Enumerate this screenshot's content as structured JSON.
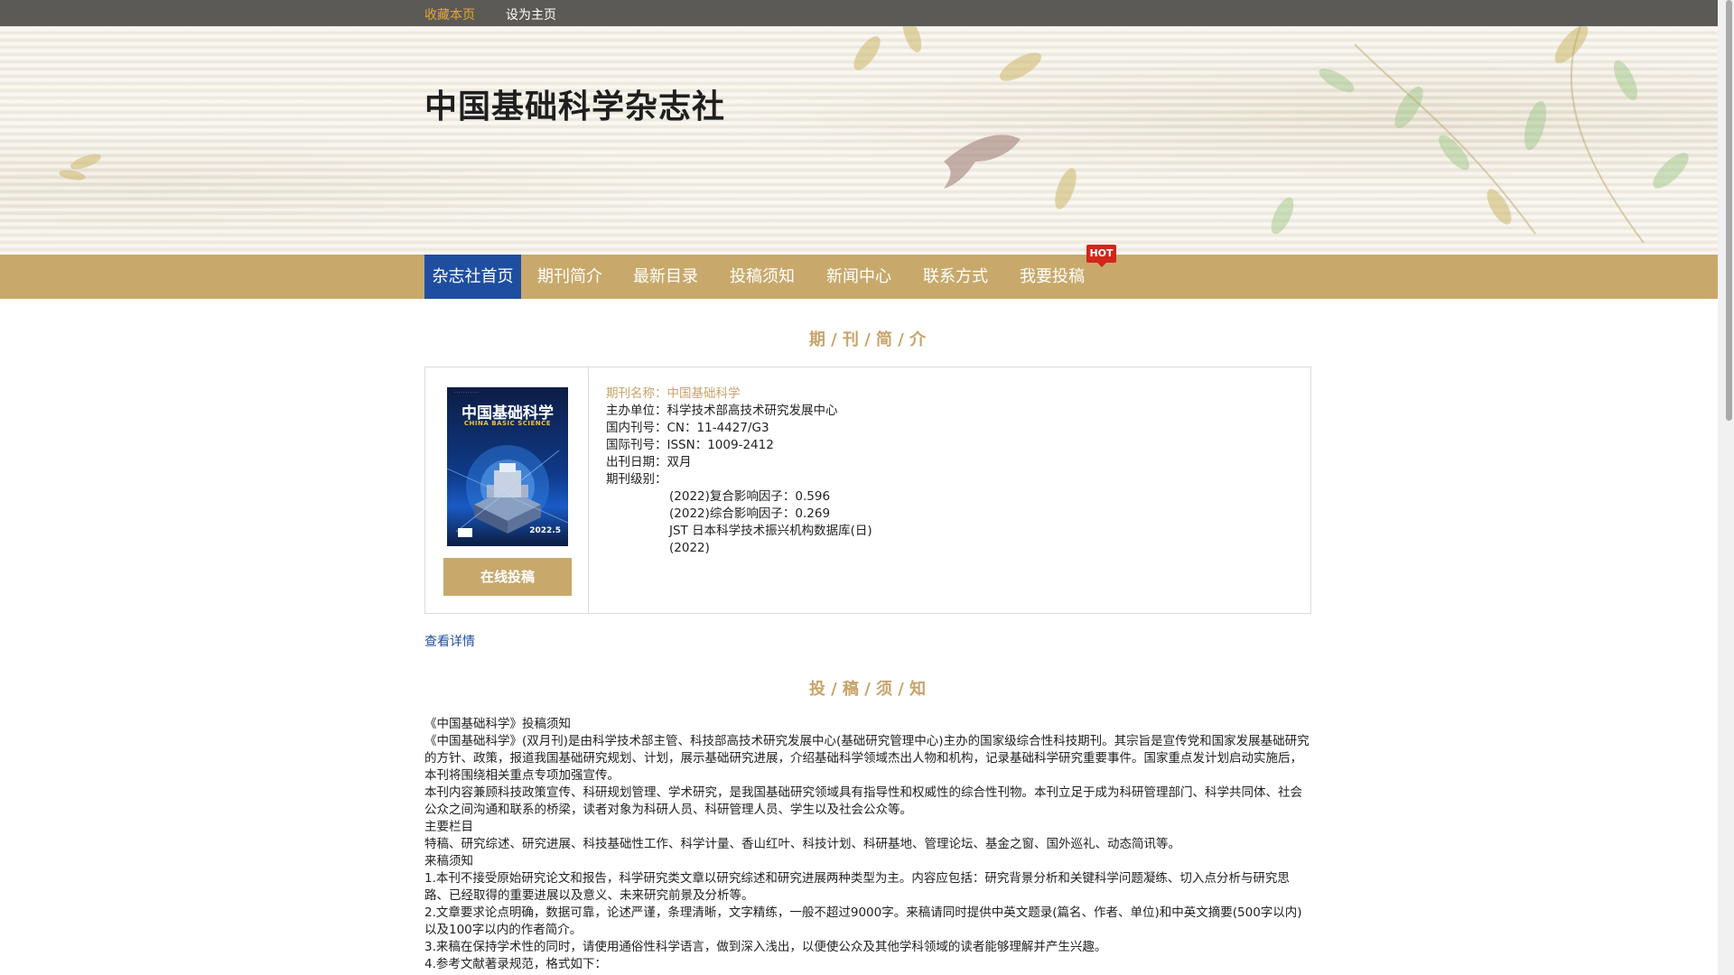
{
  "topbar": {
    "favorite_label": "收藏本页",
    "set_home_label": "设为主页"
  },
  "header": {
    "site_title": "中国基础科学杂志社"
  },
  "nav": {
    "items": [
      {
        "label": "杂志社首页",
        "active": true
      },
      {
        "label": "期刊简介"
      },
      {
        "label": "最新目录"
      },
      {
        "label": "投稿须知"
      },
      {
        "label": "新闻中心"
      },
      {
        "label": "联系方式"
      },
      {
        "label": "我要投稿"
      }
    ],
    "hot_badge": "HOT"
  },
  "intro": {
    "section_title": "期 / 刊 / 简 / 介",
    "cover": {
      "title_cn": "中国基础科学",
      "title_en": "CHINA BASIC SCIENCE",
      "issue": "2022.5"
    },
    "submit_button": "在线投稿",
    "info": {
      "name_line": "期刊名称：中国基础科学",
      "sponsor": "主办单位：科学技术部高技术研究发展中心",
      "cn_number": "国内刊号：CN：11-4427/G3",
      "issn": "国际刊号：ISSN：1009-2412",
      "frequency": "出刊日期：双月",
      "level_label": "期刊级别：",
      "levels": [
        "(2022)复合影响因子：0.596",
        "(2022)综合影响因子：0.269",
        "JST 日本科学技术振兴机构数据库(日)",
        "(2022)"
      ]
    },
    "more_link": "查看详情"
  },
  "notes": {
    "section_title": "投 / 稿 / 须 / 知",
    "paragraphs": [
      "《中国基础科学》投稿须知",
      "《中国基础科学》(双月刊)是由科学技术部主管、科技部高技术研究发展中心(基础研究管理中心)主办的国家级综合性科技期刊。其宗旨是宣传党和国家发展基础研究的方针、政策，报道我国基础研究规划、计划，展示基础研究进展，介绍基础科学领域杰出人物和机构，记录基础科学研究重要事件。国家重点发计划启动实施后，本刊将围绕相关重点专项加强宣传。",
      "本刊内容兼顾科技政策宣传、科研规划管理、学术研究，是我国基础研究领域具有指导性和权威性的综合性刊物。本刊立足于成为科研管理部门、科学共同体、社会公众之间沟通和联系的桥梁，读者对象为科研人员、科研管理人员、学生以及社会公众等。",
      "主要栏目",
      "特稿、研究综述、研究进展、科技基础性工作、科学计量、香山红叶、科技计划、科研基地、管理论坛、基金之窗、国外巡礼、动态简讯等。",
      "来稿须知",
      "1.本刊不接受原始研究论文和报告，科学研究类文章以研究综述和研究进展两种类型为主。内容应包括：研究背景分析和关键科学问题凝练、切入点分析与研究思路、已经取得的重要进展以及意义、未来研究前景及分析等。",
      "2.文章要求论点明确，数据可靠，论述严谨，条理清晰，文字精练，一般不超过9000字。来稿请同时提供中英文题录(篇名、作者、单位)和中英文摘要(500字以内)以及100字以内的作者简介。",
      "3.来稿在保持学术性的同时，请使用通俗性科学语言，做到深入浅出，以便使公众及其他学科领域的读者能够理解并产生兴趣。",
      "4.参考文献著录规范，格式如下："
    ]
  }
}
